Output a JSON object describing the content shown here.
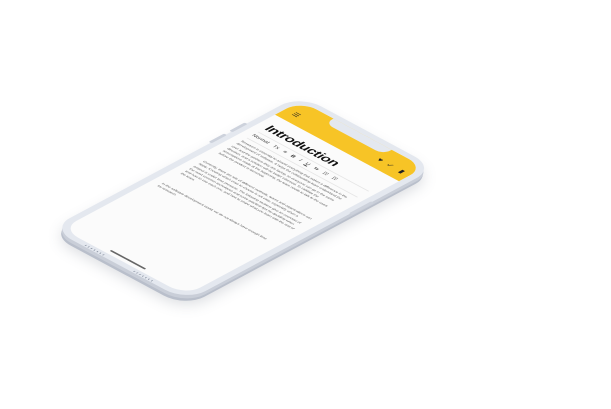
{
  "topbar": {
    "menu_icon": "menu-icon",
    "favorite_icon": "heart-icon",
    "confirm_icon": "check-icon",
    "delete_icon": "trash-icon",
    "background_color": "#f7c426"
  },
  "breadcrumb": "",
  "editor": {
    "title": "Introduction",
    "style_label": "Normal",
    "toolbar": [
      "Tx",
      "≡",
      "B",
      "I",
      "U",
      "⇆",
      "☷",
      "☷"
    ]
  },
  "paragraphs": [
    "Research is essential to almost everything that makes a difference in the development of software. It helps the collaborating team understand the user and the problem they are facing, so everyone can go in the same direction, and a solution will be better informed. To validate the assumptions made at the beginning, the team needs to talk to the users before the product is launched.",
    "Currently, there are lots of different methods, teams and organizations can apply. Knowing which ones to choose is not easy, especially when a project is under time pressure. The following sections give an overview of the most common techniques and some practical tips for deciding when and how to use each one, and how to share what you learn with the rest of the team.",
    "In the software development world, we do not always have enough time for research."
  ]
}
